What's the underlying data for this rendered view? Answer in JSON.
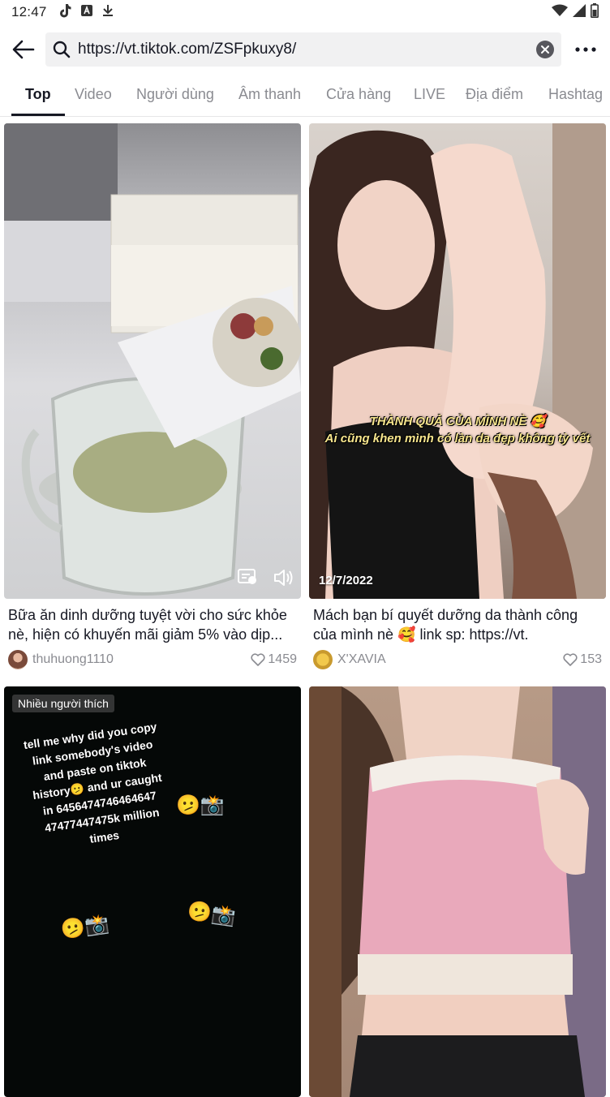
{
  "status_bar": {
    "time": "12:47",
    "icons": [
      "tiktok-icon",
      "app-icon",
      "download-icon",
      "wifi-icon",
      "signal-icon",
      "battery-icon"
    ]
  },
  "search": {
    "query": "https://vt.tiktok.com/ZSFpkuxy8/"
  },
  "tabs": [
    {
      "label": "Top",
      "active": true
    },
    {
      "label": "Video"
    },
    {
      "label": "Người dùng"
    },
    {
      "label": "Âm thanh"
    },
    {
      "label": "Cửa hàng"
    },
    {
      "label": "LIVE"
    },
    {
      "label": "Địa điểm"
    },
    {
      "label": "Hashtag"
    }
  ],
  "results": [
    {
      "caption": "Bữa ăn dinh dưỡng tuyệt vời cho sức khỏe nè, hiện có khuyến mãi giảm 5% vào dịp...",
      "author": "thuhuong1110",
      "likes": "1459"
    },
    {
      "date": "12/7/2022",
      "overlay_line1": "THÀNH QUẢ CỦA MÌNH NÈ 🥰",
      "overlay_line2": "Ai cũng khen mình có làn da đẹp không tỳ vết",
      "caption": "Mách bạn bí quyết dưỡng da thành công của mình nè 🥰 link sp: https://vt.",
      "author": "X'XAVIA",
      "likes": "153"
    },
    {
      "badge": "Nhiều người thích",
      "overlay_text": "tell me why did you copy link somebody's video and paste on tiktok history🫤 and ur caught in 6456474746464647 47477447475k million times",
      "emoji": "🫤📸"
    },
    {}
  ],
  "colors": {
    "accent": "#161823",
    "muted": "#8a8b91",
    "search_bg": "#f1f1f2",
    "overlay_text": "#f6e58d"
  }
}
